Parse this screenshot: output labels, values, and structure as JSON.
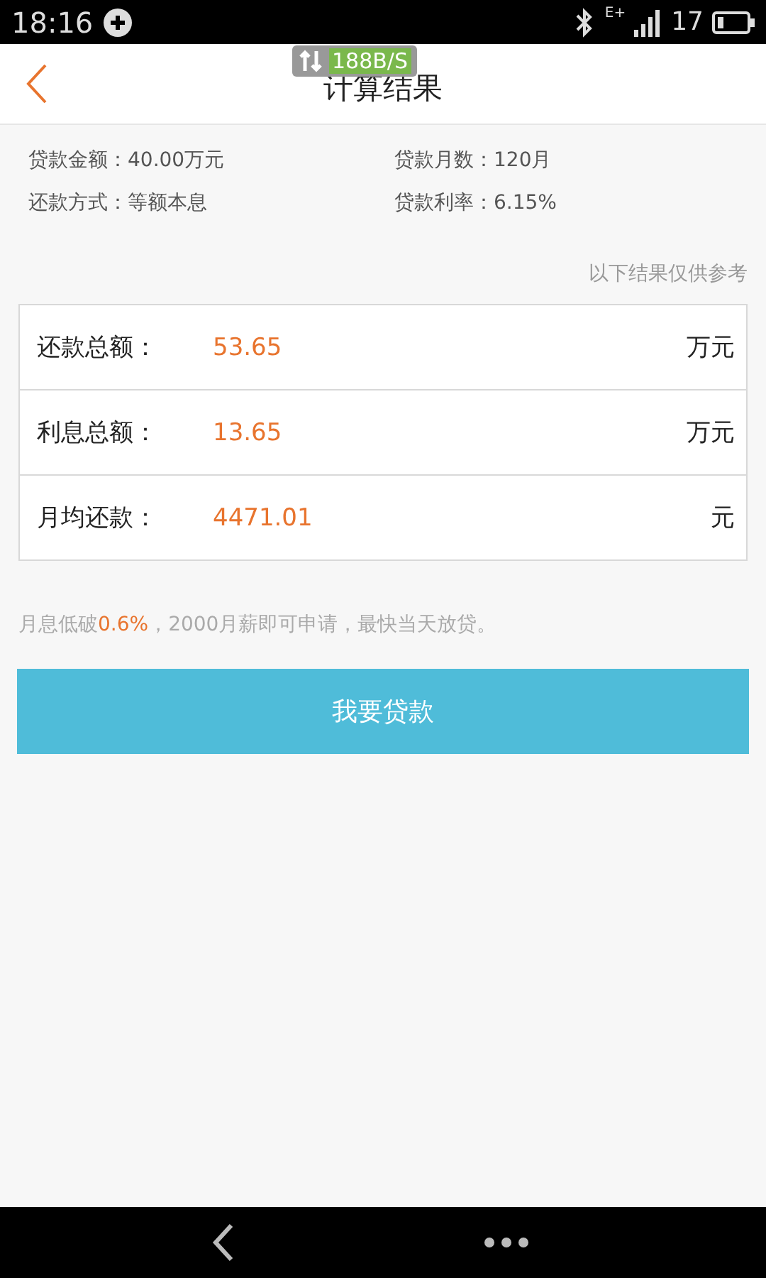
{
  "status_bar": {
    "time": "18:16",
    "signal_label": "E+",
    "battery": "17"
  },
  "speed_overlay": {
    "text": "188B/S"
  },
  "header": {
    "title": "计算结果"
  },
  "summary": [
    {
      "text": "贷款金额：40.00万元"
    },
    {
      "text": "贷款月数：120月"
    },
    {
      "text": "还款方式：等额本息"
    },
    {
      "text": "贷款利率：6.15%"
    }
  ],
  "note": "以下结果仅供参考",
  "results": [
    {
      "label": "还款总额：",
      "value": "53.65",
      "unit": "万元"
    },
    {
      "label": "利息总额：",
      "value": "13.65",
      "unit": "万元"
    },
    {
      "label": "月均还款：",
      "value": "4471.01",
      "unit": "元"
    }
  ],
  "promo": {
    "before": "月息低破",
    "highlight": "0.6%",
    "after": "，2000月薪即可申请，最快当天放贷。"
  },
  "apply_button": "我要贷款"
}
